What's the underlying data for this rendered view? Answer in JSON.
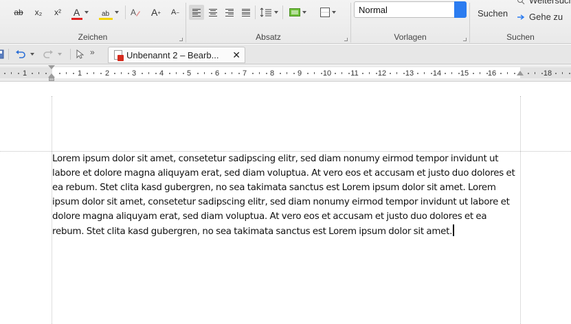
{
  "ribbon": {
    "groups": {
      "zeichen": "Zeichen",
      "absatz": "Absatz",
      "vorlagen": "Vorlagen",
      "suchen": "Suchen"
    },
    "buttons": {
      "strikethrough": "ab",
      "subscript": "x₂",
      "superscript": "x²",
      "font_color": "A",
      "highlight": "ab",
      "grow_font": "A",
      "shrink_font": "A"
    },
    "style_value": "Normal",
    "search_label": "Suchen",
    "find_next_label": "Weitersuchen",
    "goto_label": "Gehe zu",
    "colors": {
      "font_color_bar": "#e02020",
      "highlight_bar": "#f4d400",
      "shading": "#6fbf3a",
      "accent": "#2b7cf0"
    }
  },
  "tabbar": {
    "document_tab": "Unbenannt 2 – Bearb...",
    "close_symbol": "✕",
    "overflow_symbol": "»"
  },
  "ruler": {
    "labels": [
      "1",
      "1",
      "2",
      "3",
      "4",
      "5",
      "6",
      "7",
      "8",
      "9",
      "10",
      "11",
      "12",
      "13",
      "14",
      "15",
      "16",
      "18"
    ]
  },
  "document": {
    "text": "Lorem ipsum dolor sit amet, consetetur sadipscing elitr, sed diam nonumy eirmod tempor invidunt ut labore et dolore magna aliquyam erat, sed diam voluptua. At vero eos et accusam et justo duo dolores et ea rebum. Stet clita kasd gubergren, no sea takimata sanctus est Lorem ipsum dolor sit amet. Lorem ipsum dolor sit amet, consetetur sadipscing elitr, sed diam nonumy eirmod tempor invidunt ut labore et dolore magna aliquyam erat, sed diam voluptua. At vero eos et accusam et justo duo dolores et ea rebum. Stet clita kasd gubergren, no sea takimata sanctus est Lorem ipsum dolor sit amet."
  }
}
